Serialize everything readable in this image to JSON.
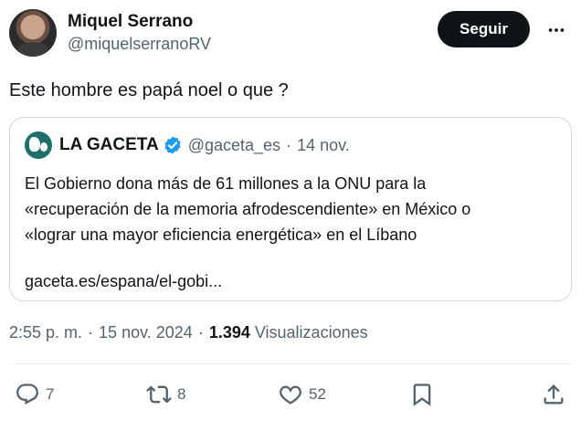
{
  "author": {
    "display_name": "Miquel Serrano",
    "handle": "@miquelserranoRV",
    "follow_label": "Seguir",
    "more_icon": "more-dots-icon"
  },
  "tweet": {
    "text": "Este hombre es papá noel o que ?"
  },
  "quote": {
    "name": "LA GACETA",
    "verified": true,
    "handle": "@gaceta_es",
    "separator": "·",
    "date": "14 nov.",
    "body_lines": [
      "El Gobierno dona más de 61 millones a la ONU para la",
      "«recuperación de la memoria afrodescendiente» en México o",
      "«lograr una mayor eficiencia energética» en el Líbano"
    ],
    "link": "gaceta.es/espana/el-gobi..."
  },
  "meta": {
    "time": "2:55 p. m.",
    "separator": "·",
    "date": "15 nov. 2024",
    "views_count": "1.394",
    "views_label": "Visualizaciones"
  },
  "actions": {
    "replies": "7",
    "reposts": "8",
    "likes": "52"
  },
  "colors": {
    "text": "#0f1419",
    "secondary": "#536471",
    "border": "#cfd9de",
    "verified": "#1d9bf0",
    "button_bg": "#0f1419"
  }
}
